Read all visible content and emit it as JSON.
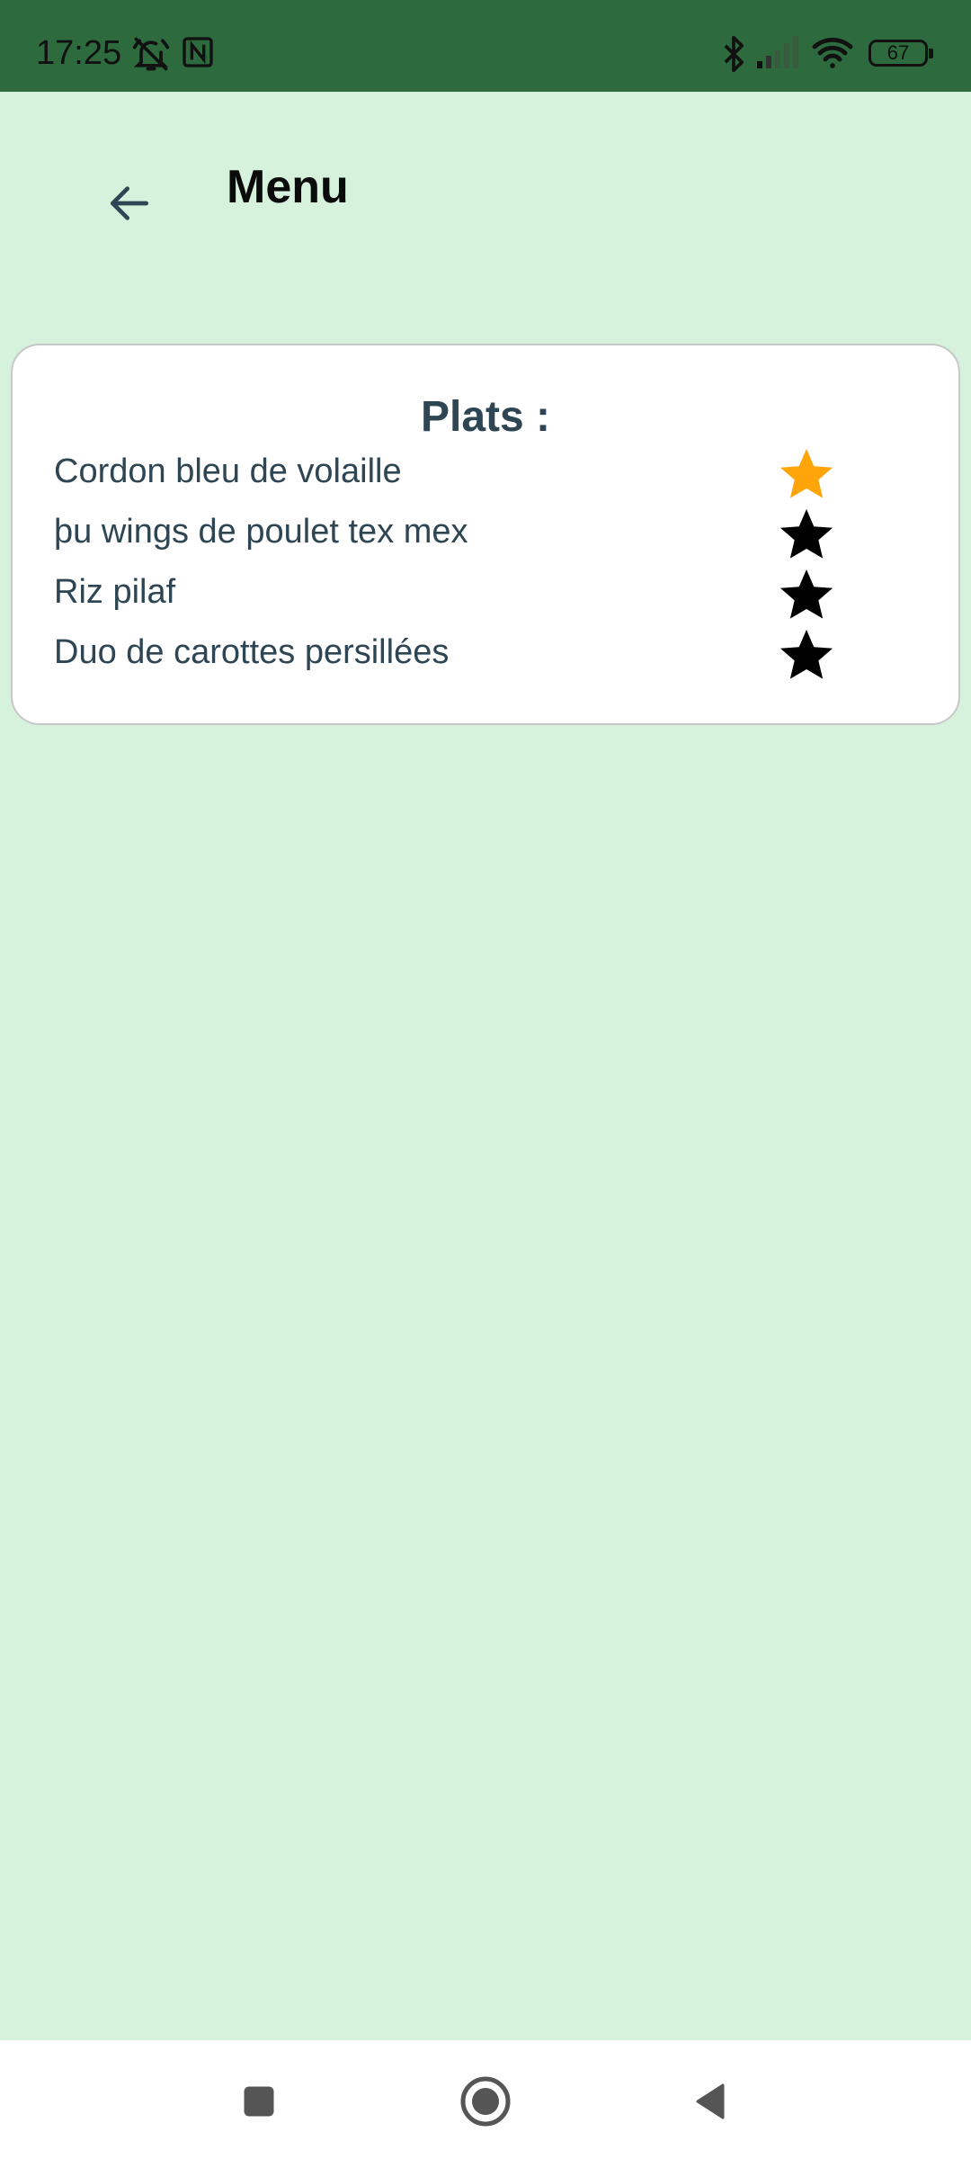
{
  "status_bar": {
    "time": "17:25",
    "battery": "67",
    "icons": [
      "bell-off-icon",
      "nfc-icon",
      "bluetooth-icon",
      "signal-icon",
      "wifi-icon",
      "battery-icon"
    ]
  },
  "app_bar": {
    "title": "Menu",
    "back_icon": "arrow-left-icon"
  },
  "menu": {
    "heading": "Plats :",
    "items": [
      {
        "name": "Cordon bleu de volaille",
        "favorite": true
      },
      {
        "name": "þu wings de poulet tex mex",
        "favorite": false
      },
      {
        "name": "Riz pilaf",
        "favorite": false
      },
      {
        "name": "Duo de carottes persillées",
        "favorite": false
      }
    ]
  },
  "colors": {
    "background": "#d6f1dc",
    "status_bar": "#2d6a3e",
    "text": "#2e4553",
    "star_active": "#ffa50a",
    "star_inactive": "#000000"
  },
  "nav_bar": {
    "buttons": [
      "recents-square-icon",
      "home-circle-icon",
      "back-triangle-icon"
    ]
  }
}
